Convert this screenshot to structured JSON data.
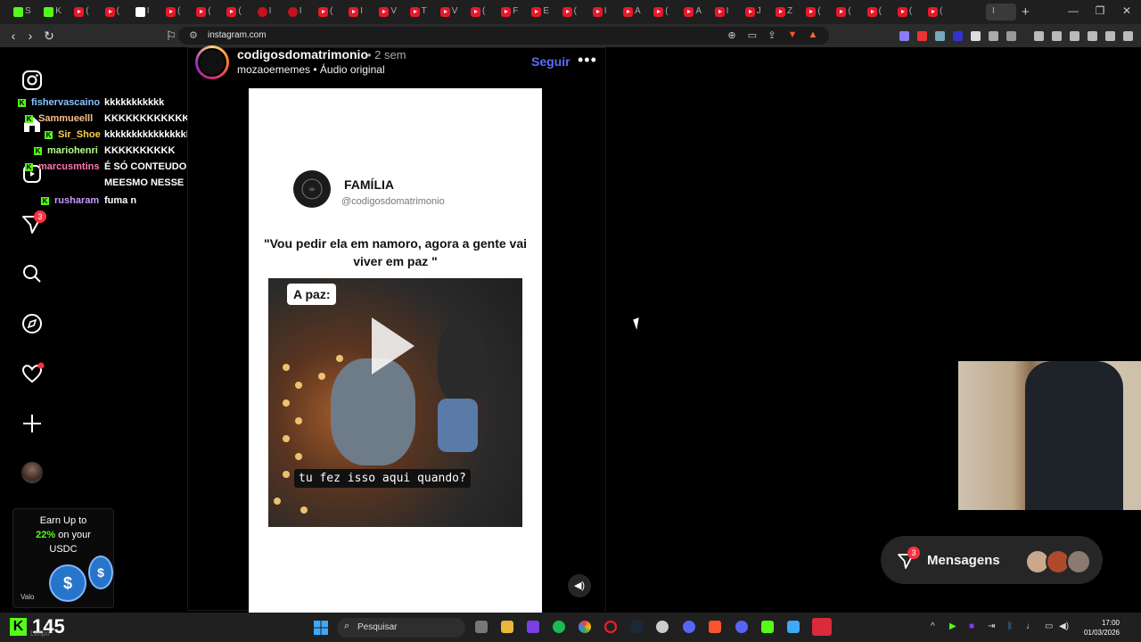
{
  "browser": {
    "url": "instagram.com",
    "active_tab_glyph": "I",
    "tab_close": "✕",
    "new_tab": "+",
    "tabs": [
      {
        "icon": "kick",
        "text": "S"
      },
      {
        "icon": "kick",
        "text": "K"
      },
      {
        "icon": "yt",
        "text": "("
      },
      {
        "icon": "yt",
        "text": "("
      },
      {
        "icon": "dark",
        "text": "I"
      },
      {
        "icon": "yt",
        "text": "("
      },
      {
        "icon": "yt",
        "text": "("
      },
      {
        "icon": "yt",
        "text": "("
      },
      {
        "icon": "red",
        "text": "I"
      },
      {
        "icon": "red",
        "text": "I"
      },
      {
        "icon": "yt",
        "text": "("
      },
      {
        "icon": "yt",
        "text": "I"
      },
      {
        "icon": "yt",
        "text": "V"
      },
      {
        "icon": "yt",
        "text": "T"
      },
      {
        "icon": "yt",
        "text": "V"
      },
      {
        "icon": "yt",
        "text": "("
      },
      {
        "icon": "yt",
        "text": "F"
      },
      {
        "icon": "yt",
        "text": "E"
      },
      {
        "icon": "yt",
        "text": "("
      },
      {
        "icon": "yt",
        "text": "I"
      },
      {
        "icon": "yt",
        "text": "A"
      },
      {
        "icon": "yt",
        "text": "("
      },
      {
        "icon": "yt",
        "text": "A"
      },
      {
        "icon": "yt",
        "text": "I"
      },
      {
        "icon": "yt",
        "text": "J"
      },
      {
        "icon": "yt",
        "text": "Z"
      },
      {
        "icon": "yt",
        "text": "("
      },
      {
        "icon": "yt",
        "text": "("
      },
      {
        "icon": "yt",
        "text": "("
      },
      {
        "icon": "yt",
        "text": "("
      },
      {
        "icon": "yt",
        "text": "("
      }
    ]
  },
  "sidebar": {
    "notification_badge": "3"
  },
  "chat": [
    {
      "user": "fishervascaino",
      "color": "#8ac4ff",
      "message": "kkkkkkkkkkk"
    },
    {
      "user": "Sammueelll",
      "color": "#f5c08a",
      "message": "KKKKKKKKKKKKKKKKKK"
    },
    {
      "user": "Sir_Shoe",
      "color": "#ffd24a",
      "message": "kkkkkkkkkkkkkkkkk"
    },
    {
      "user": "mariohenri",
      "color": "#b6ff8a",
      "message": "KKKKKKKKKK"
    },
    {
      "user": "marcusmtins",
      "color": "#ff7ab0",
      "message": "É SÓ CONTEUDO DE CASADO"
    },
    {
      "user": "",
      "color": "#ffffff",
      "message": "MEESMO NESSE INSTAGRAM?"
    },
    {
      "user": "rusharam",
      "color": "#c79bff",
      "message": "fuma n"
    }
  ],
  "post": {
    "username": "codigosdomatrimonio",
    "time_ago": "• 2 sem",
    "audio_line": "mozaoememes • Áudio original",
    "follow_label": "Seguir",
    "more_label": "•••",
    "card": {
      "title": "FAMÍLIA",
      "handle": "@codigosdomatrimonio",
      "quote": "\"Vou pedir ela em namoro, agora a gente vai viver em paz \"",
      "video_caption_top": "A paz:",
      "video_subtitle": "tu fez isso aqui quando?"
    }
  },
  "messages": {
    "label": "Mensagens",
    "badge": "3"
  },
  "ad": {
    "line1": "Earn Up to",
    "line2_highlight": "22%",
    "line2_rest": " on your",
    "line3": "USDC",
    "brand": "Valo"
  },
  "taskbar": {
    "viewer_count": "145",
    "status": "Limpo",
    "search_placeholder": "Pesquisar",
    "time": "17:00",
    "date": "01/03/2026"
  },
  "colors": {
    "kick_green": "#53fc18",
    "follow_blue": "#5b6cf9",
    "badge_red": "#ff3040"
  }
}
